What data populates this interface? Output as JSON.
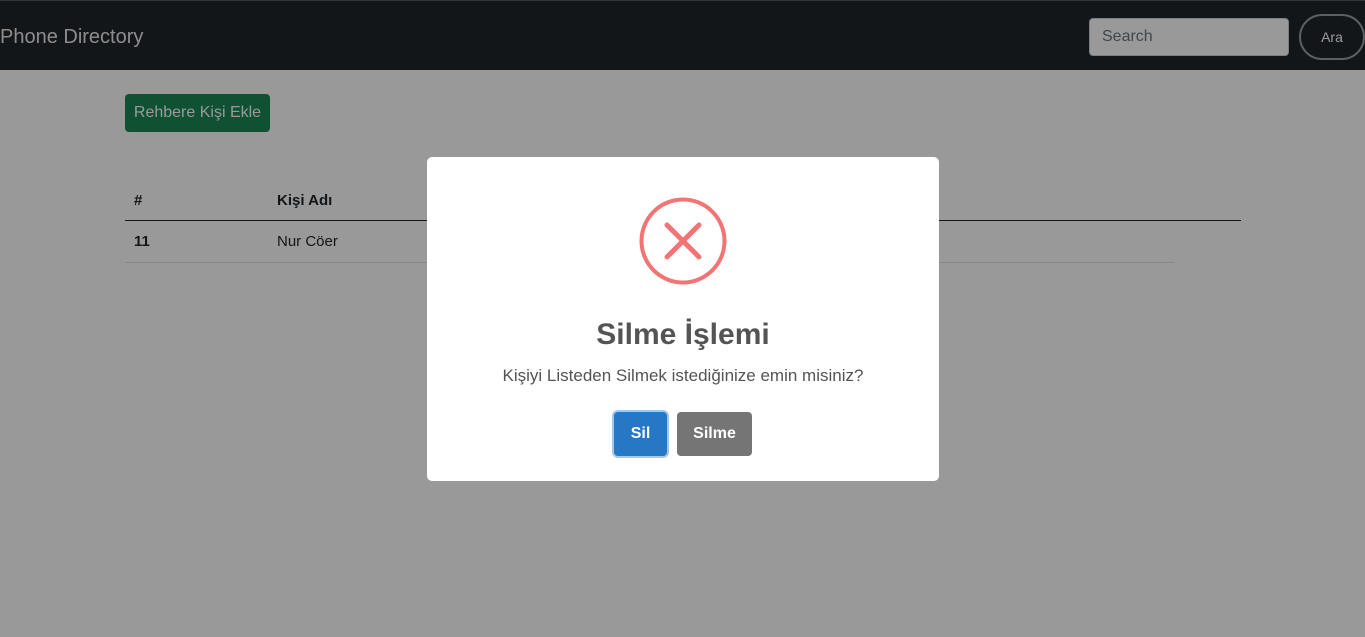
{
  "navbar": {
    "brand": "Phone Directory",
    "search_placeholder": "Search",
    "search_value": "",
    "search_button": "Ara"
  },
  "main": {
    "add_button": "Rehbere Kişi Ekle",
    "table": {
      "columns": [
        "#",
        "Kişi Adı"
      ],
      "rows": [
        {
          "id": "11",
          "name": "Nur Cöer"
        }
      ]
    }
  },
  "modal": {
    "icon": "error-x-icon",
    "title": "Silme İşlemi",
    "text": "Kişiyi Listeden Silmek istediğinize emin misiniz?",
    "confirm_button": "Sil",
    "cancel_button": "Silme"
  },
  "colors": {
    "navbar_bg": "#212529",
    "add_button_bg": "#198754",
    "confirm_bg": "#2778c4",
    "cancel_bg": "#757575",
    "error_icon": "#f27474"
  }
}
